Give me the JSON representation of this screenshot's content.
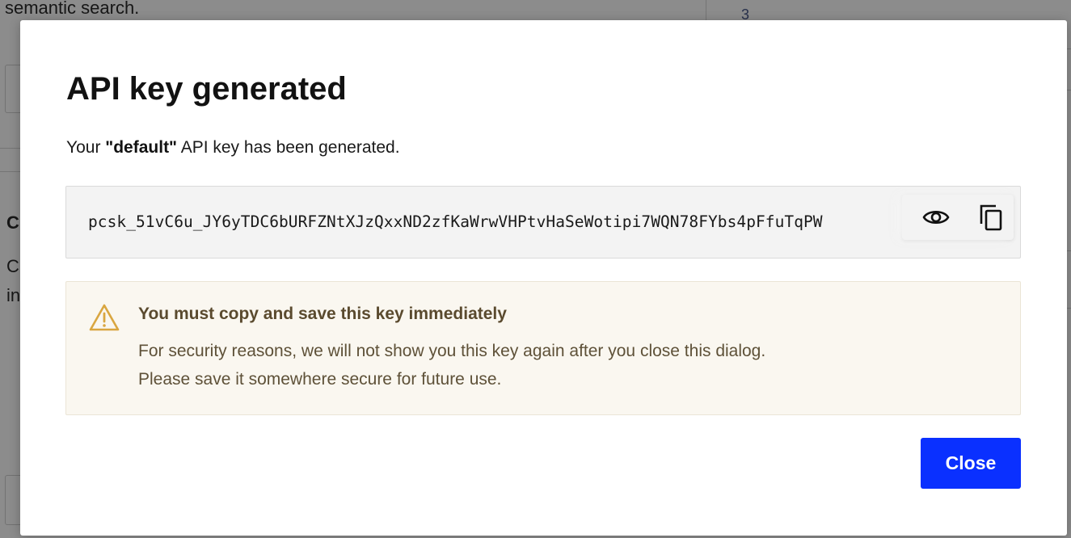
{
  "background": {
    "partial_text_top": "semantic search.",
    "partial_number_right": "3",
    "partial_letter_left_1": "C",
    "partial_letter_left_2": "C",
    "partial_letters_left_3": "in"
  },
  "dialog": {
    "title": "API key generated",
    "description_prefix": "Your ",
    "key_name": "\"default\"",
    "description_suffix": " API key has been generated.",
    "api_key": "pcsk_51vC6u_JY6yTDC6bURFZNtXJzQxxND2zfKaWrwVHPtvHaSeWotipi7WQN78FYbs4pFfuTqPW",
    "reveal_icon": "eye-icon",
    "copy_icon": "copy-icon",
    "warning": {
      "icon": "warning-triangle-icon",
      "title": "You must copy and save this key immediately",
      "line1": "For security reasons, we will not show you this key again after you close this dialog.",
      "line2": "Please save it somewhere secure for future use."
    },
    "close_label": "Close"
  },
  "colors": {
    "primary_button": "#0a30ff",
    "warning_background": "#faf7f0",
    "warning_icon": "#d9a640",
    "warning_text": "#5a4a2e",
    "key_box_background": "#f3f3f3"
  }
}
